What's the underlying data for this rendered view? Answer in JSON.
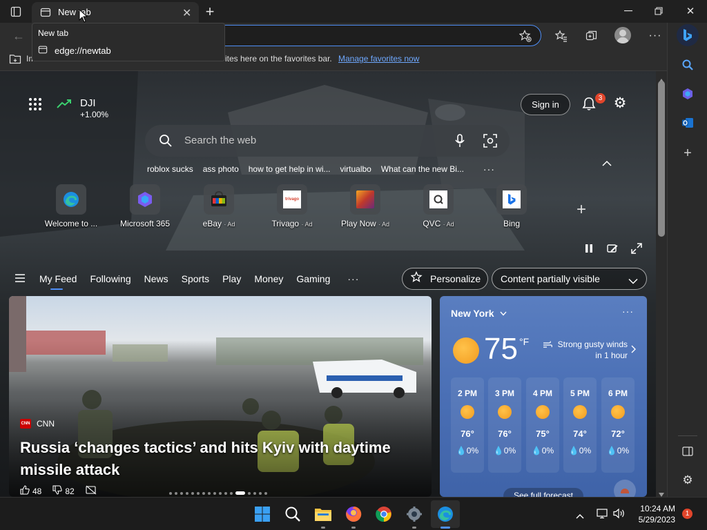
{
  "browser": {
    "tab_title": "New tab",
    "tooltip_title": "New tab",
    "tooltip_url": "edge://newtab",
    "favbar_text": "ites here on the favorites bar.",
    "favbar_prefix": "Im",
    "manage_favorites": "Manage favorites now"
  },
  "ntp": {
    "ticker_symbol": "DJI",
    "ticker_change": "+1.00%",
    "sign_in": "Sign in",
    "notif_count": "3",
    "search_placeholder": "Search the web",
    "trending": [
      "roblox sucks",
      "ass photo",
      "how to get help in wi...",
      "virtualbo",
      "What can the new Bi..."
    ],
    "quick_links": [
      {
        "label": "Welcome to ...",
        "ad": ""
      },
      {
        "label": "Microsoft 365",
        "ad": ""
      },
      {
        "label": "eBay",
        "ad": "· Ad"
      },
      {
        "label": "Trivago",
        "ad": "· Ad"
      },
      {
        "label": "Play Now",
        "ad": "· Ad"
      },
      {
        "label": "QVC",
        "ad": "· Ad"
      },
      {
        "label": "Bing",
        "ad": ""
      }
    ],
    "nav_tabs": [
      "My Feed",
      "Following",
      "News",
      "Sports",
      "Play",
      "Money",
      "Gaming"
    ],
    "personalize": "Personalize",
    "content_visibility": "Content partially visible"
  },
  "hero": {
    "source": "CNN",
    "source_logo": "CNN",
    "headline_line1": "Russia ‘changes tactics’ and hits Kyiv with daytime",
    "headline_line2": "missile attack",
    "likes": "48",
    "dislikes": "82"
  },
  "weather": {
    "city": "New York",
    "temp": "75",
    "unit": "°F",
    "alert_line1": "Strong gusty winds",
    "alert_line2": "in 1 hour",
    "hours": [
      {
        "time": "2 PM",
        "temp": "76°",
        "precip": "0%"
      },
      {
        "time": "3 PM",
        "temp": "76°",
        "precip": "0%"
      },
      {
        "time": "4 PM",
        "temp": "75°",
        "precip": "0%"
      },
      {
        "time": "5 PM",
        "temp": "74°",
        "precip": "0%"
      },
      {
        "time": "6 PM",
        "temp": "72°",
        "precip": "0%"
      }
    ],
    "full_forecast": "See full forecast"
  },
  "taskbar": {
    "time": "10:24 AM",
    "date": "5/29/2023",
    "notif_count": "1"
  },
  "colors": {
    "accent": "#4f8ff7",
    "link": "#6ea8fe",
    "weather_card": "#4a6fb5"
  }
}
